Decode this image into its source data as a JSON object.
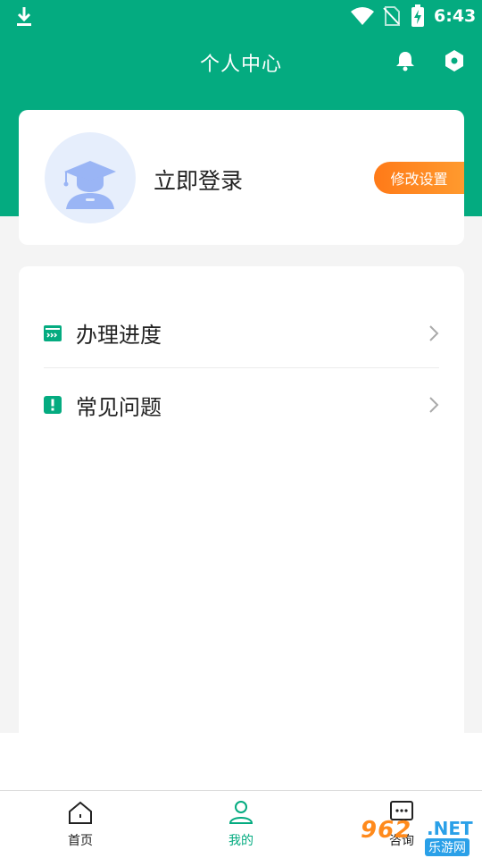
{
  "status_bar": {
    "time": "6:43"
  },
  "header": {
    "title": "个人中心"
  },
  "profile": {
    "login_text": "立即登录",
    "edit_settings": "修改设置"
  },
  "menu": {
    "items": [
      {
        "label": "办理进度",
        "icon": "progress-card-icon"
      },
      {
        "label": "常见问题",
        "icon": "exclamation-icon"
      }
    ]
  },
  "tabs": [
    {
      "label": "首页",
      "icon": "home-icon",
      "active": false
    },
    {
      "label": "我的",
      "icon": "user-icon",
      "active": true
    },
    {
      "label": "咨询",
      "icon": "chat-icon",
      "active": false
    }
  ],
  "watermark": {
    "number": "962",
    "domain": ".NET",
    "site": "乐游网"
  },
  "colors": {
    "primary": "#04ab80",
    "accent": "#ff7a18",
    "avatar_bg": "#e6eefc"
  }
}
